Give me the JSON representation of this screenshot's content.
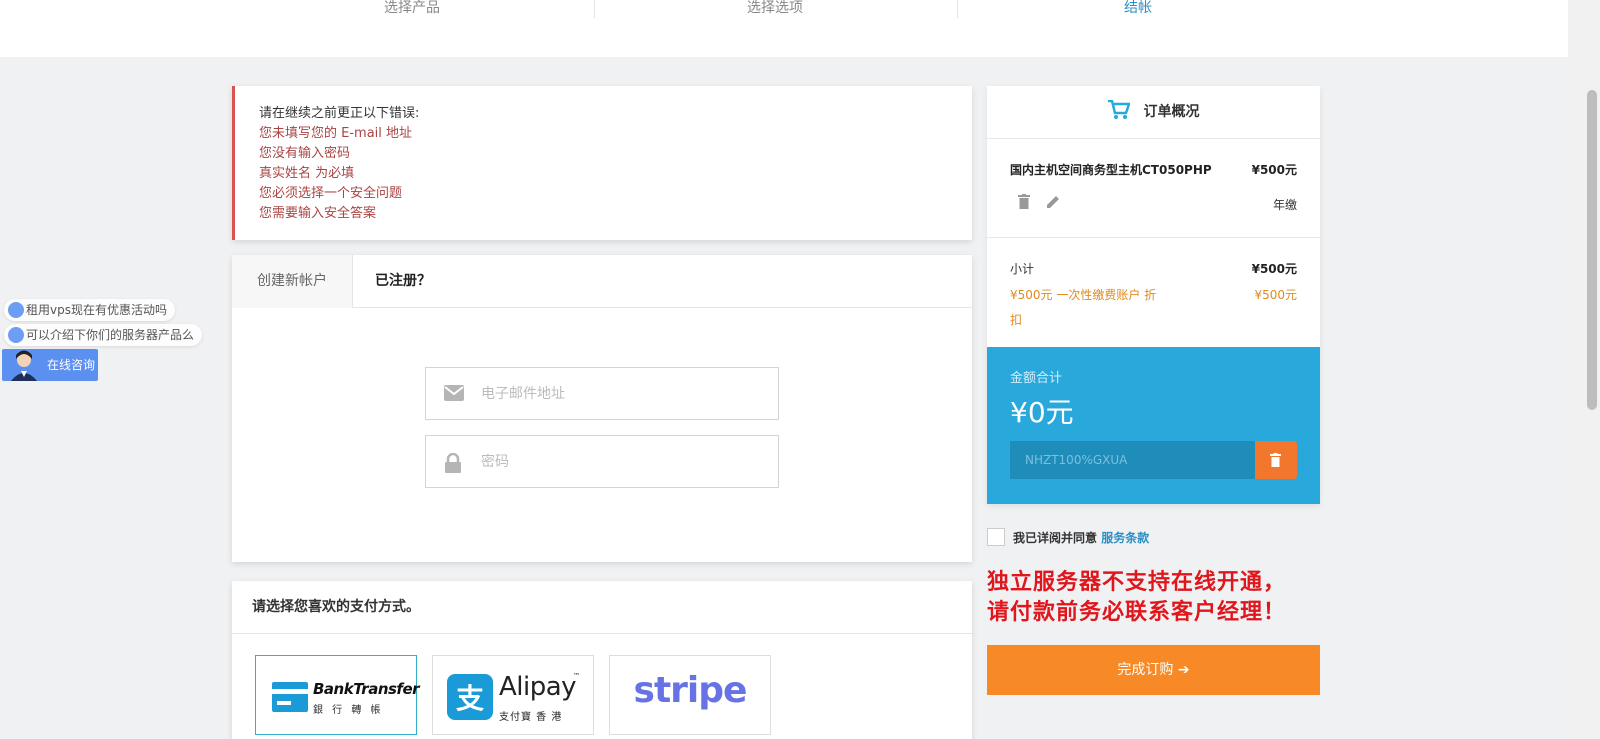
{
  "steps": [
    "选择产品",
    "选择选项",
    "结帐"
  ],
  "errors": {
    "title": "请在继续之前更正以下错误:",
    "items": [
      "您未填写您的 E-mail 地址",
      "您没有输入密码",
      "真实姓名 为必填",
      "您必须选择一个安全问题",
      "您需要输入安全答案"
    ]
  },
  "account": {
    "tab_new": "创建新帐户",
    "tab_existing": "已注册？",
    "email_placeholder": "电子邮件地址",
    "password_placeholder": "密码"
  },
  "payment": {
    "heading": "请选择您喜欢的支付方式。",
    "options": [
      "BankTransfer",
      "Alipay",
      "stripe"
    ],
    "bank_sub": "銀 行 轉 帳",
    "alipay_sub": "支付寶 香 港",
    "alipay_tm": "™"
  },
  "summary": {
    "title": "订单概况",
    "product_name": "国内主机空间商务型主机CT050PHP",
    "product_price": "¥500元",
    "product_cycle": "年缴",
    "subtotal_label": "小计",
    "subtotal_value": "¥500元",
    "discount_label_1": "¥500元 一次性缴费账户 折",
    "discount_label_2": "扣",
    "discount_value": "¥500元",
    "total_label": "金额合计",
    "total_value": "¥0元",
    "promo_code": "NHZT100%GXUA"
  },
  "tos": {
    "text": "我已详阅并同意",
    "link": "服务条款"
  },
  "warning": {
    "line1": "独立服务器不支持在线开通，",
    "line2": "请付款前务必联系客户经理！"
  },
  "complete_button": "完成订购 ➔",
  "chat": {
    "bubble1": "租用vps现在有优惠活动吗",
    "bubble2": "可以介绍下你们的服务器产品么",
    "label": "在线咨询"
  },
  "colors": {
    "accent": "#29a8dc",
    "orange": "#f78a26",
    "error": "#a94442",
    "warning": "#e0161c"
  }
}
